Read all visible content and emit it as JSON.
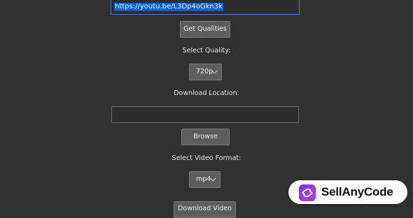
{
  "url_input": {
    "value": "https://youtu.be/L3Dp4oGkn3k"
  },
  "buttons": {
    "get_qualities": "Get Qualities",
    "browse": "Browse",
    "download_video": "Download Video"
  },
  "labels": {
    "select_quality": "Select Quality:",
    "download_location": "Download Location:",
    "select_format": "Select Video Format:"
  },
  "quality_select": {
    "selected": "720p"
  },
  "location_input": {
    "value": ""
  },
  "format_select": {
    "selected": "mp4"
  },
  "watermark": {
    "text": "SellAnyCode",
    "colors": {
      "icon_gradient_start": "#7b2ff7",
      "icon_gradient_end": "#c43ad6"
    }
  },
  "colors": {
    "background": "#303030",
    "button": "#5d5d5d",
    "selection": "#0a5ecf",
    "focus_border": "#4a7ad0"
  }
}
